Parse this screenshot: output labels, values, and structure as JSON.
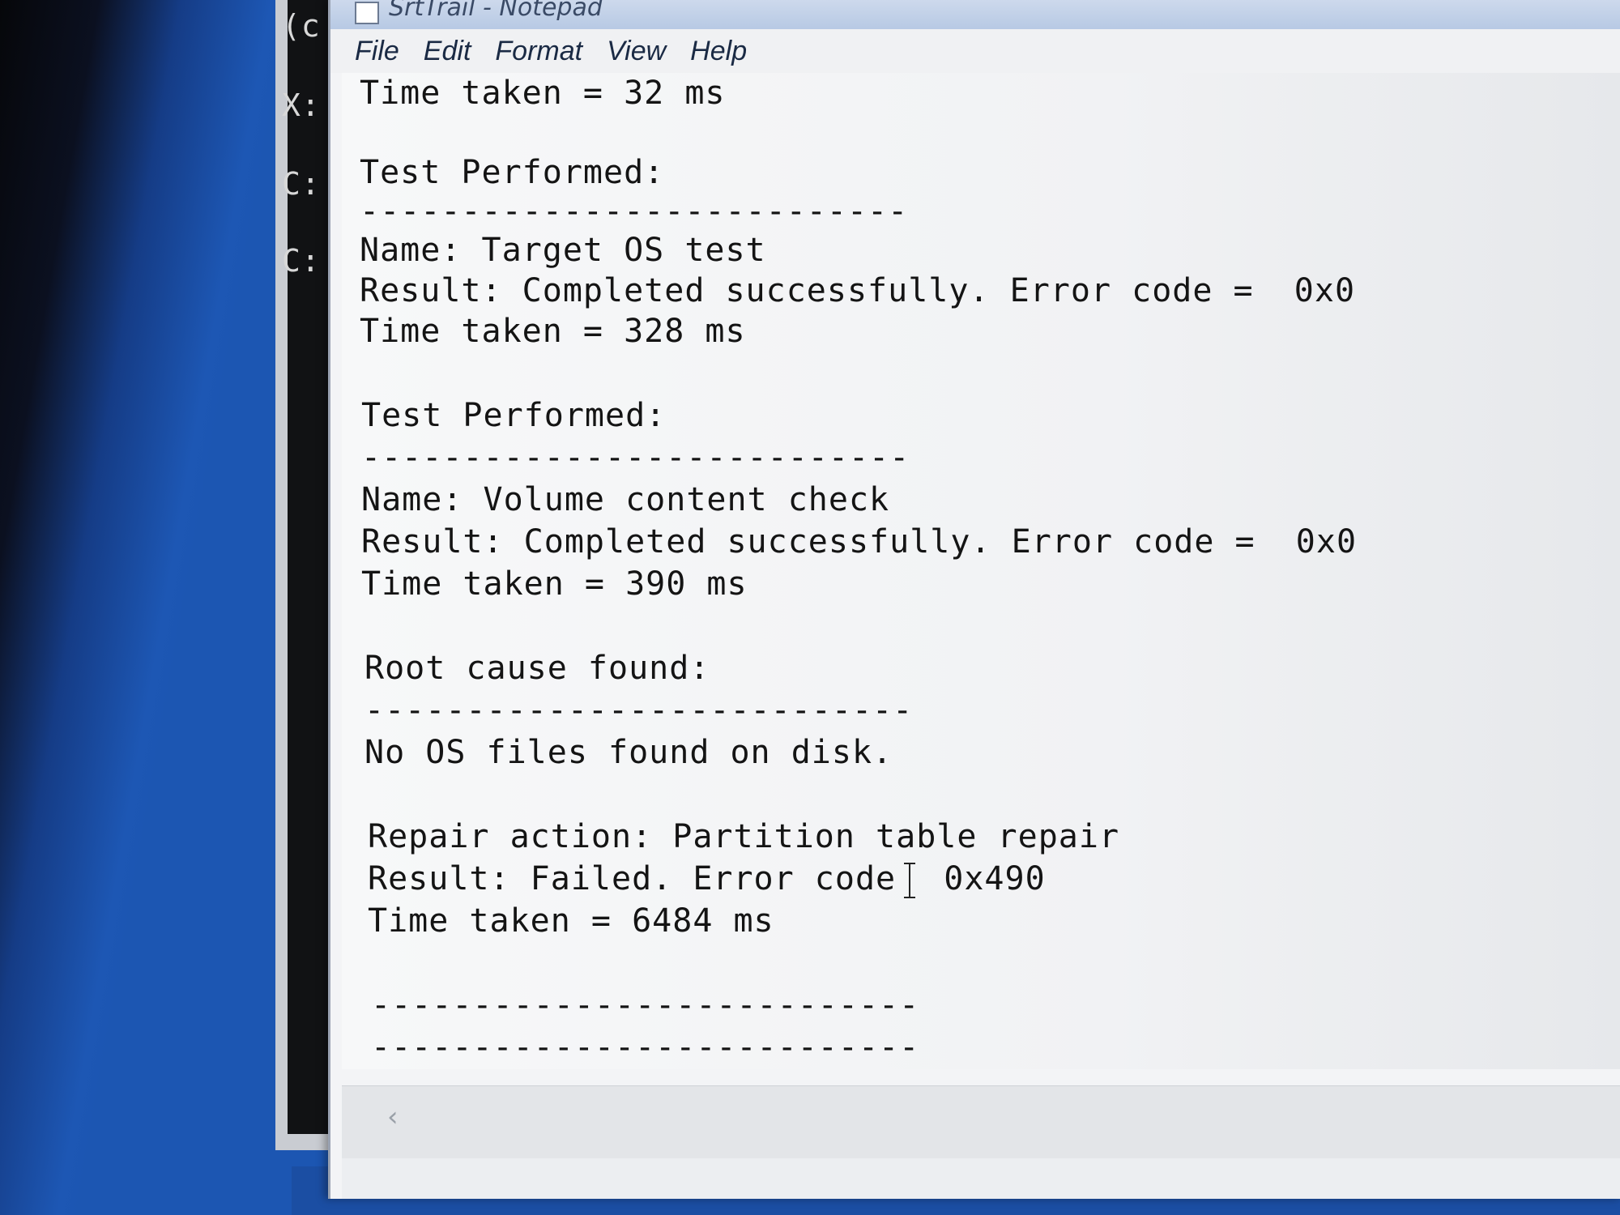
{
  "window": {
    "title": "SrtTrail - Notepad"
  },
  "console": {
    "prompts": [
      "(c",
      "X:",
      "C:",
      "C:"
    ]
  },
  "menu": {
    "file": "File",
    "edit": "Edit",
    "format": "Format",
    "view": "View",
    "help": "Help"
  },
  "document": {
    "lines": [
      "Time taken = 32 ms",
      "Test Performed:",
      "---------------------------",
      "Name: Target OS test",
      "Result: Completed successfully. Error code =  0x0",
      "Time taken = 328 ms",
      "Test Performed:",
      "---------------------------",
      "Name: Volume content check",
      "Result: Completed successfully. Error code =  0x0",
      "Time taken = 390 ms",
      "Root cause found:",
      "---------------------------",
      "No OS files found on disk.",
      "Repair action: Partition table repair",
      "Time taken = 6484 ms",
      "---------------------------",
      "---------------------------"
    ],
    "failed_result": {
      "prefix": "Result: Failed. Error code",
      "code": "0x490"
    }
  },
  "scrollbar": {
    "left_arrow": "‹"
  }
}
